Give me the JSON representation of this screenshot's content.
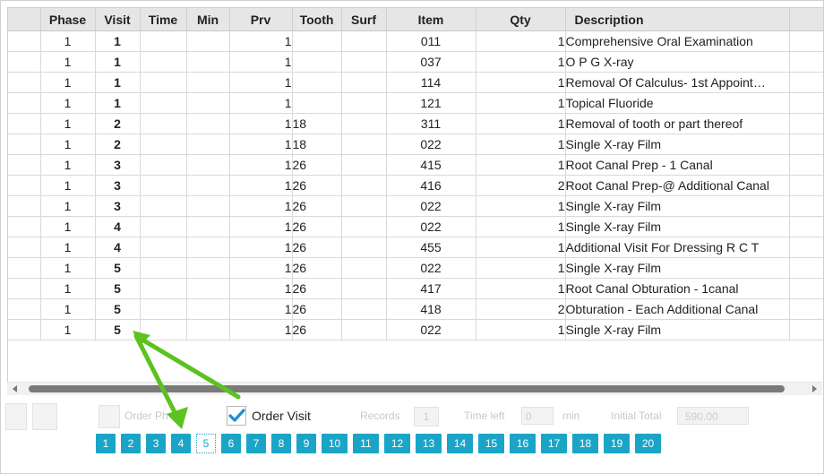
{
  "columns": [
    "",
    "Phase",
    "Visit",
    "Time",
    "Min",
    "Prv",
    "Tooth",
    "Surf",
    "Item",
    "Qty",
    "Description",
    ""
  ],
  "rows": [
    {
      "phase": "1",
      "visit": "1",
      "time": "",
      "min": "",
      "prv": "1",
      "tooth": "",
      "surf": "",
      "item": "011",
      "qty": "1",
      "desc": "Comprehensive Oral Examination"
    },
    {
      "phase": "1",
      "visit": "1",
      "time": "",
      "min": "",
      "prv": "1",
      "tooth": "",
      "surf": "",
      "item": "037",
      "qty": "1",
      "desc": "O P G X-ray"
    },
    {
      "phase": "1",
      "visit": "1",
      "time": "",
      "min": "",
      "prv": "1",
      "tooth": "",
      "surf": "",
      "item": "114",
      "qty": "1",
      "desc": "Removal Of Calculus- 1st Appoint…"
    },
    {
      "phase": "1",
      "visit": "1",
      "time": "",
      "min": "",
      "prv": "1",
      "tooth": "",
      "surf": "",
      "item": "121",
      "qty": "1",
      "desc": "Topical Fluoride"
    },
    {
      "phase": "1",
      "visit": "2",
      "time": "",
      "min": "",
      "prv": "1",
      "tooth": "18",
      "surf": "",
      "item": "311",
      "qty": "1",
      "desc": "Removal of tooth or part thereof"
    },
    {
      "phase": "1",
      "visit": "2",
      "time": "",
      "min": "",
      "prv": "1",
      "tooth": "18",
      "surf": "",
      "item": "022",
      "qty": "1",
      "desc": "Single X-ray Film"
    },
    {
      "phase": "1",
      "visit": "3",
      "time": "",
      "min": "",
      "prv": "1",
      "tooth": "26",
      "surf": "",
      "item": "415",
      "qty": "1",
      "desc": "Root Canal Prep - 1 Canal"
    },
    {
      "phase": "1",
      "visit": "3",
      "time": "",
      "min": "",
      "prv": "1",
      "tooth": "26",
      "surf": "",
      "item": "416",
      "qty": "2",
      "desc": "Root Canal Prep-@ Additional Canal"
    },
    {
      "phase": "1",
      "visit": "3",
      "time": "",
      "min": "",
      "prv": "1",
      "tooth": "26",
      "surf": "",
      "item": "022",
      "qty": "1",
      "desc": "Single X-ray Film"
    },
    {
      "phase": "1",
      "visit": "4",
      "time": "",
      "min": "",
      "prv": "1",
      "tooth": "26",
      "surf": "",
      "item": "022",
      "qty": "1",
      "desc": "Single X-ray Film"
    },
    {
      "phase": "1",
      "visit": "4",
      "time": "",
      "min": "",
      "prv": "1",
      "tooth": "26",
      "surf": "",
      "item": "455",
      "qty": "1",
      "desc": "Additional Visit For Dressing R C T"
    },
    {
      "phase": "1",
      "visit": "5",
      "time": "",
      "min": "",
      "prv": "1",
      "tooth": "26",
      "surf": "",
      "item": "022",
      "qty": "1",
      "desc": "Single X-ray Film"
    },
    {
      "phase": "1",
      "visit": "5",
      "time": "",
      "min": "",
      "prv": "1",
      "tooth": "26",
      "surf": "",
      "item": "417",
      "qty": "1",
      "desc": "Root Canal Obturation - 1canal"
    },
    {
      "phase": "1",
      "visit": "5",
      "time": "",
      "min": "",
      "prv": "1",
      "tooth": "26",
      "surf": "",
      "item": "418",
      "qty": "2",
      "desc": "Obturation - Each Additional Canal"
    },
    {
      "phase": "1",
      "visit": "5",
      "time": "",
      "min": "",
      "prv": "1",
      "tooth": "26",
      "surf": "",
      "item": "022",
      "qty": "1",
      "desc": "Single X-ray Film"
    }
  ],
  "footer": {
    "order_visit_label": "Order Visit",
    "order_visit_checked": true,
    "faded_order_label": "Order Ph",
    "faded_records_label": "Records",
    "faded_records_value": "1",
    "faded_time_left_label": "Time left",
    "faded_time_left_value": "0",
    "faded_min_label": "min",
    "faded_initial_label": "Initial Total",
    "faded_initial_value": "590.00"
  },
  "pager": {
    "pages": [
      "1",
      "2",
      "3",
      "4",
      "5",
      "6",
      "7",
      "8",
      "9",
      "10",
      "11",
      "12",
      "13",
      "14",
      "15",
      "16",
      "17",
      "18",
      "19",
      "20"
    ],
    "active": "5"
  },
  "colors": {
    "visit_cell": "#f7aaa0",
    "visit_text": "#b0111a",
    "cream_cell": "#fdf6df",
    "pager_button": "#1aa5c7",
    "annotation_arrow": "#5cc21f",
    "checkbox_check": "#1a8fd0"
  },
  "icons": {
    "checkbox": "check-icon",
    "scroll_left": "arrow-left-icon",
    "scroll_right": "arrow-right-icon"
  }
}
